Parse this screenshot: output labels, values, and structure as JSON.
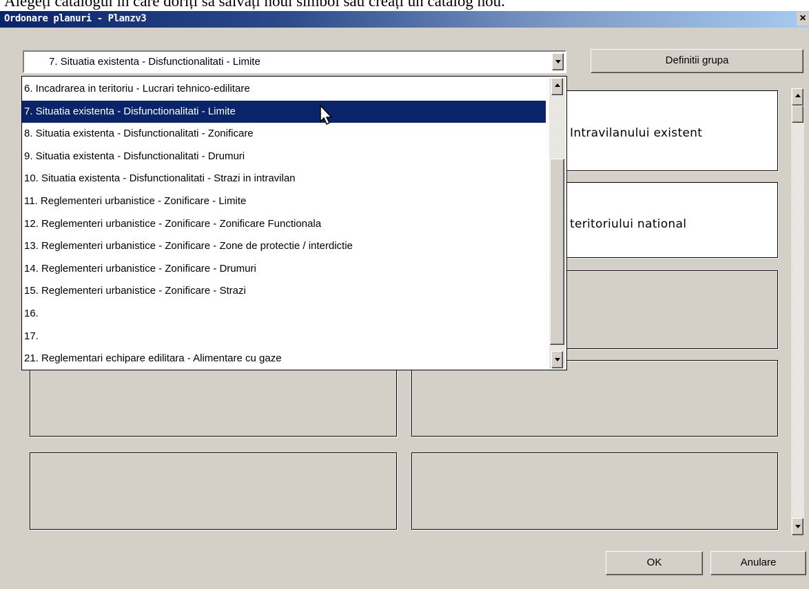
{
  "background_text": "Alegeți catalogul în care doriți să salvați noul simbol sau creați un catalog nou.",
  "window": {
    "title": "Ordonare planuri - Planzv3",
    "close_label": "×"
  },
  "combo": {
    "selected": "7. Situatia existenta - Disfunctionalitati - Limite"
  },
  "buttons": {
    "definitii": "Definitii grupa",
    "ok": "OK",
    "cancel": "Anulare"
  },
  "panels": {
    "right_1_text": "Intravilanului existent",
    "right_2_text": "teritoriului national"
  },
  "dropdown": {
    "selected_index": 1,
    "items": [
      "6. Incadrarea in teritoriu - Lucrari tehnico-edilitare",
      "7. Situatia existenta - Disfunctionalitati - Limite",
      "8. Situatia existenta - Disfunctionalitati - Zonificare",
      "9. Situatia existenta - Disfunctionalitati - Drumuri",
      "10. Situatia existenta - Disfunctionalitati - Strazi in intravilan",
      "11. Reglementeri urbanistice - Zonificare - Limite",
      "12. Reglementeri urbanistice - Zonificare - Zonificare Functionala",
      "13. Reglementeri urbanistice - Zonificare - Zone de protectie / interdictie",
      "14. Reglementeri urbanistice - Zonificare - Drumuri",
      "15. Reglementeri urbanistice - Zonificare - Strazi",
      "16.",
      "17.",
      "21. Reglementari echipare edilitara - Alimentare cu gaze"
    ]
  },
  "colors": {
    "face": "#d4d0c8",
    "selection": "#0a246a",
    "titlebar_start": "#0a246a",
    "titlebar_end": "#a6caf0"
  }
}
